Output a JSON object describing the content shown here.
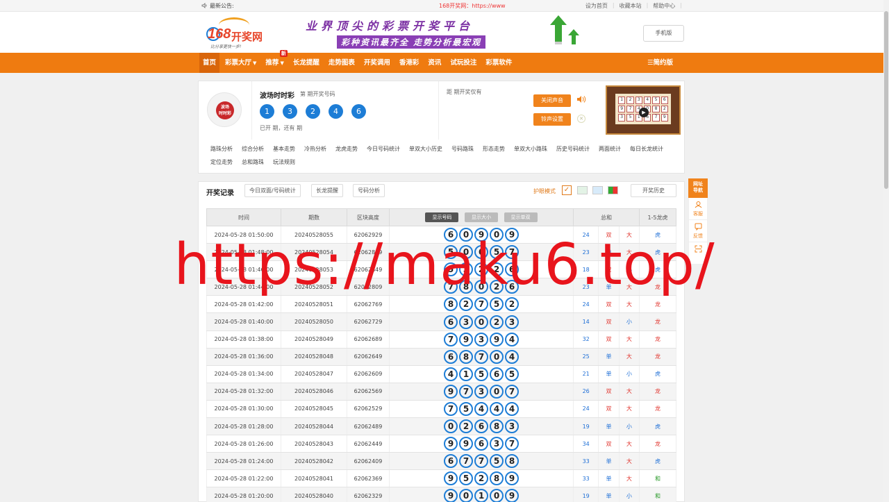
{
  "topbar": {
    "notice_label": "最新公告:",
    "marquee": "168开奖网：https://www",
    "links": [
      "设为首页",
      "收藏本站",
      "帮助中心"
    ]
  },
  "header": {
    "logo_num": "168",
    "logo_cn": "开奖网",
    "logo_slogan": "比分享更快一步!",
    "banner_line1": "业界顶尖的彩票开奖平台",
    "banner_line2": "彩种资讯最齐全  走势分析最宏观",
    "mobile_btn": "手机版"
  },
  "nav": {
    "items": [
      {
        "label": "首页",
        "active": true,
        "caret": false
      },
      {
        "label": "彩票大厅",
        "caret": true
      },
      {
        "label": "推荐",
        "caret": true,
        "badge": "新"
      },
      {
        "label": "长龙提醒"
      },
      {
        "label": "走势图表"
      },
      {
        "label": "开奖调用"
      },
      {
        "label": "香港彩"
      },
      {
        "label": "资讯"
      },
      {
        "label": "试玩投注"
      },
      {
        "label": "彩票软件"
      }
    ],
    "simple_mode": "☰简约版"
  },
  "game": {
    "title": "波场时时彩",
    "sub": "第    期开奖号码",
    "balls": [
      "1",
      "3",
      "2",
      "4",
      "6"
    ],
    "status": "已开    期，还有    期",
    "next_draw": "距    期开奖仅有",
    "mute_btn": "关闭声音",
    "ring_btn": "铃声设置",
    "logo_text": "波场\n时时彩",
    "tabs": [
      "路珠分析",
      "综合分析",
      "基本走势",
      "冷热分析",
      "龙虎走势",
      "今日号码统计",
      "单双大小历史",
      "号码路珠",
      "形态走势",
      "单双大小路珠",
      "历史号码统计",
      "两面统计",
      "每日长龙统计",
      "定位走势",
      "总和路珠",
      "玩法规则"
    ]
  },
  "records": {
    "title": "开奖记录",
    "buttons": [
      "今日双面/号码统计",
      "长龙提醒",
      "号码分析"
    ],
    "eye_mode": "护眼模式",
    "history_btn": "开奖历史",
    "colors": {
      "ball": "#1d7dd6",
      "accent": "#f0831c",
      "red": "#e0312a",
      "blue": "#1d6ed6",
      "green": "#2a9a2a"
    },
    "headers": {
      "time": "时间",
      "issue": "期数",
      "block": "区块高度",
      "toggle_num": "显示号码",
      "toggle_size": "显示大小",
      "toggle_odd": "显示单双",
      "sum": "总和",
      "dragon": "1-5龙虎"
    },
    "rows": [
      {
        "time": "2024-05-28 01:50:00",
        "issue": "20240528055",
        "block": "62062929",
        "nums": [
          "6",
          "0",
          "9",
          "0",
          "9"
        ],
        "sum": "24",
        "oe": "双",
        "bs": "大",
        "dt": "虎"
      },
      {
        "time": "2024-05-28 01:48:00",
        "issue": "20240528054",
        "block": "62062889",
        "nums": [
          "5",
          "0",
          "6",
          "5",
          "7"
        ],
        "sum": "23",
        "oe": "单",
        "bs": "大",
        "dt": "虎"
      },
      {
        "time": "2024-05-28 01:46:00",
        "issue": "20240528053",
        "block": "62062849",
        "nums": [
          "5",
          "3",
          "2",
          "2",
          "6"
        ],
        "sum": "18",
        "oe": "双",
        "bs": "小",
        "dt": "虎"
      },
      {
        "time": "2024-05-28 01:44:00",
        "issue": "20240528052",
        "block": "62062809",
        "nums": [
          "7",
          "8",
          "0",
          "2",
          "6"
        ],
        "sum": "23",
        "oe": "单",
        "bs": "大",
        "dt": "龙"
      },
      {
        "time": "2024-05-28 01:42:00",
        "issue": "20240528051",
        "block": "62062769",
        "nums": [
          "8",
          "2",
          "7",
          "5",
          "2"
        ],
        "sum": "24",
        "oe": "双",
        "bs": "大",
        "dt": "龙"
      },
      {
        "time": "2024-05-28 01:40:00",
        "issue": "20240528050",
        "block": "62062729",
        "nums": [
          "6",
          "3",
          "0",
          "2",
          "3"
        ],
        "sum": "14",
        "oe": "双",
        "bs": "小",
        "dt": "龙"
      },
      {
        "time": "2024-05-28 01:38:00",
        "issue": "20240528049",
        "block": "62062689",
        "nums": [
          "7",
          "9",
          "3",
          "9",
          "4"
        ],
        "sum": "32",
        "oe": "双",
        "bs": "大",
        "dt": "龙"
      },
      {
        "time": "2024-05-28 01:36:00",
        "issue": "20240528048",
        "block": "62062649",
        "nums": [
          "6",
          "8",
          "7",
          "0",
          "4"
        ],
        "sum": "25",
        "oe": "单",
        "bs": "大",
        "dt": "龙"
      },
      {
        "time": "2024-05-28 01:34:00",
        "issue": "20240528047",
        "block": "62062609",
        "nums": [
          "4",
          "1",
          "5",
          "6",
          "5"
        ],
        "sum": "21",
        "oe": "单",
        "bs": "小",
        "dt": "虎"
      },
      {
        "time": "2024-05-28 01:32:00",
        "issue": "20240528046",
        "block": "62062569",
        "nums": [
          "9",
          "7",
          "3",
          "0",
          "7"
        ],
        "sum": "26",
        "oe": "双",
        "bs": "大",
        "dt": "龙"
      },
      {
        "time": "2024-05-28 01:30:00",
        "issue": "20240528045",
        "block": "62062529",
        "nums": [
          "7",
          "5",
          "4",
          "4",
          "4"
        ],
        "sum": "24",
        "oe": "双",
        "bs": "大",
        "dt": "龙"
      },
      {
        "time": "2024-05-28 01:28:00",
        "issue": "20240528044",
        "block": "62062489",
        "nums": [
          "0",
          "2",
          "6",
          "8",
          "3"
        ],
        "sum": "19",
        "oe": "单",
        "bs": "小",
        "dt": "虎"
      },
      {
        "time": "2024-05-28 01:26:00",
        "issue": "20240528043",
        "block": "62062449",
        "nums": [
          "9",
          "9",
          "6",
          "3",
          "7"
        ],
        "sum": "34",
        "oe": "双",
        "bs": "大",
        "dt": "龙"
      },
      {
        "time": "2024-05-28 01:24:00",
        "issue": "20240528042",
        "block": "62062409",
        "nums": [
          "6",
          "7",
          "7",
          "5",
          "8"
        ],
        "sum": "33",
        "oe": "单",
        "bs": "大",
        "dt": "虎"
      },
      {
        "time": "2024-05-28 01:22:00",
        "issue": "20240528041",
        "block": "62062369",
        "nums": [
          "9",
          "5",
          "2",
          "8",
          "9"
        ],
        "sum": "33",
        "oe": "单",
        "bs": "大",
        "dt": "和"
      },
      {
        "time": "2024-05-28 01:20:00",
        "issue": "20240528040",
        "block": "62062329",
        "nums": [
          "9",
          "0",
          "1",
          "0",
          "9"
        ],
        "sum": "19",
        "oe": "单",
        "bs": "小",
        "dt": "和"
      }
    ]
  },
  "side": {
    "hot": "网址\n导航",
    "items": [
      {
        "label": "客服",
        "icon": "headset-icon"
      },
      {
        "label": "反馈",
        "icon": "chat-icon"
      },
      {
        "label": "",
        "icon": "scan-icon"
      }
    ]
  },
  "watermark": "https://maku6.top/"
}
